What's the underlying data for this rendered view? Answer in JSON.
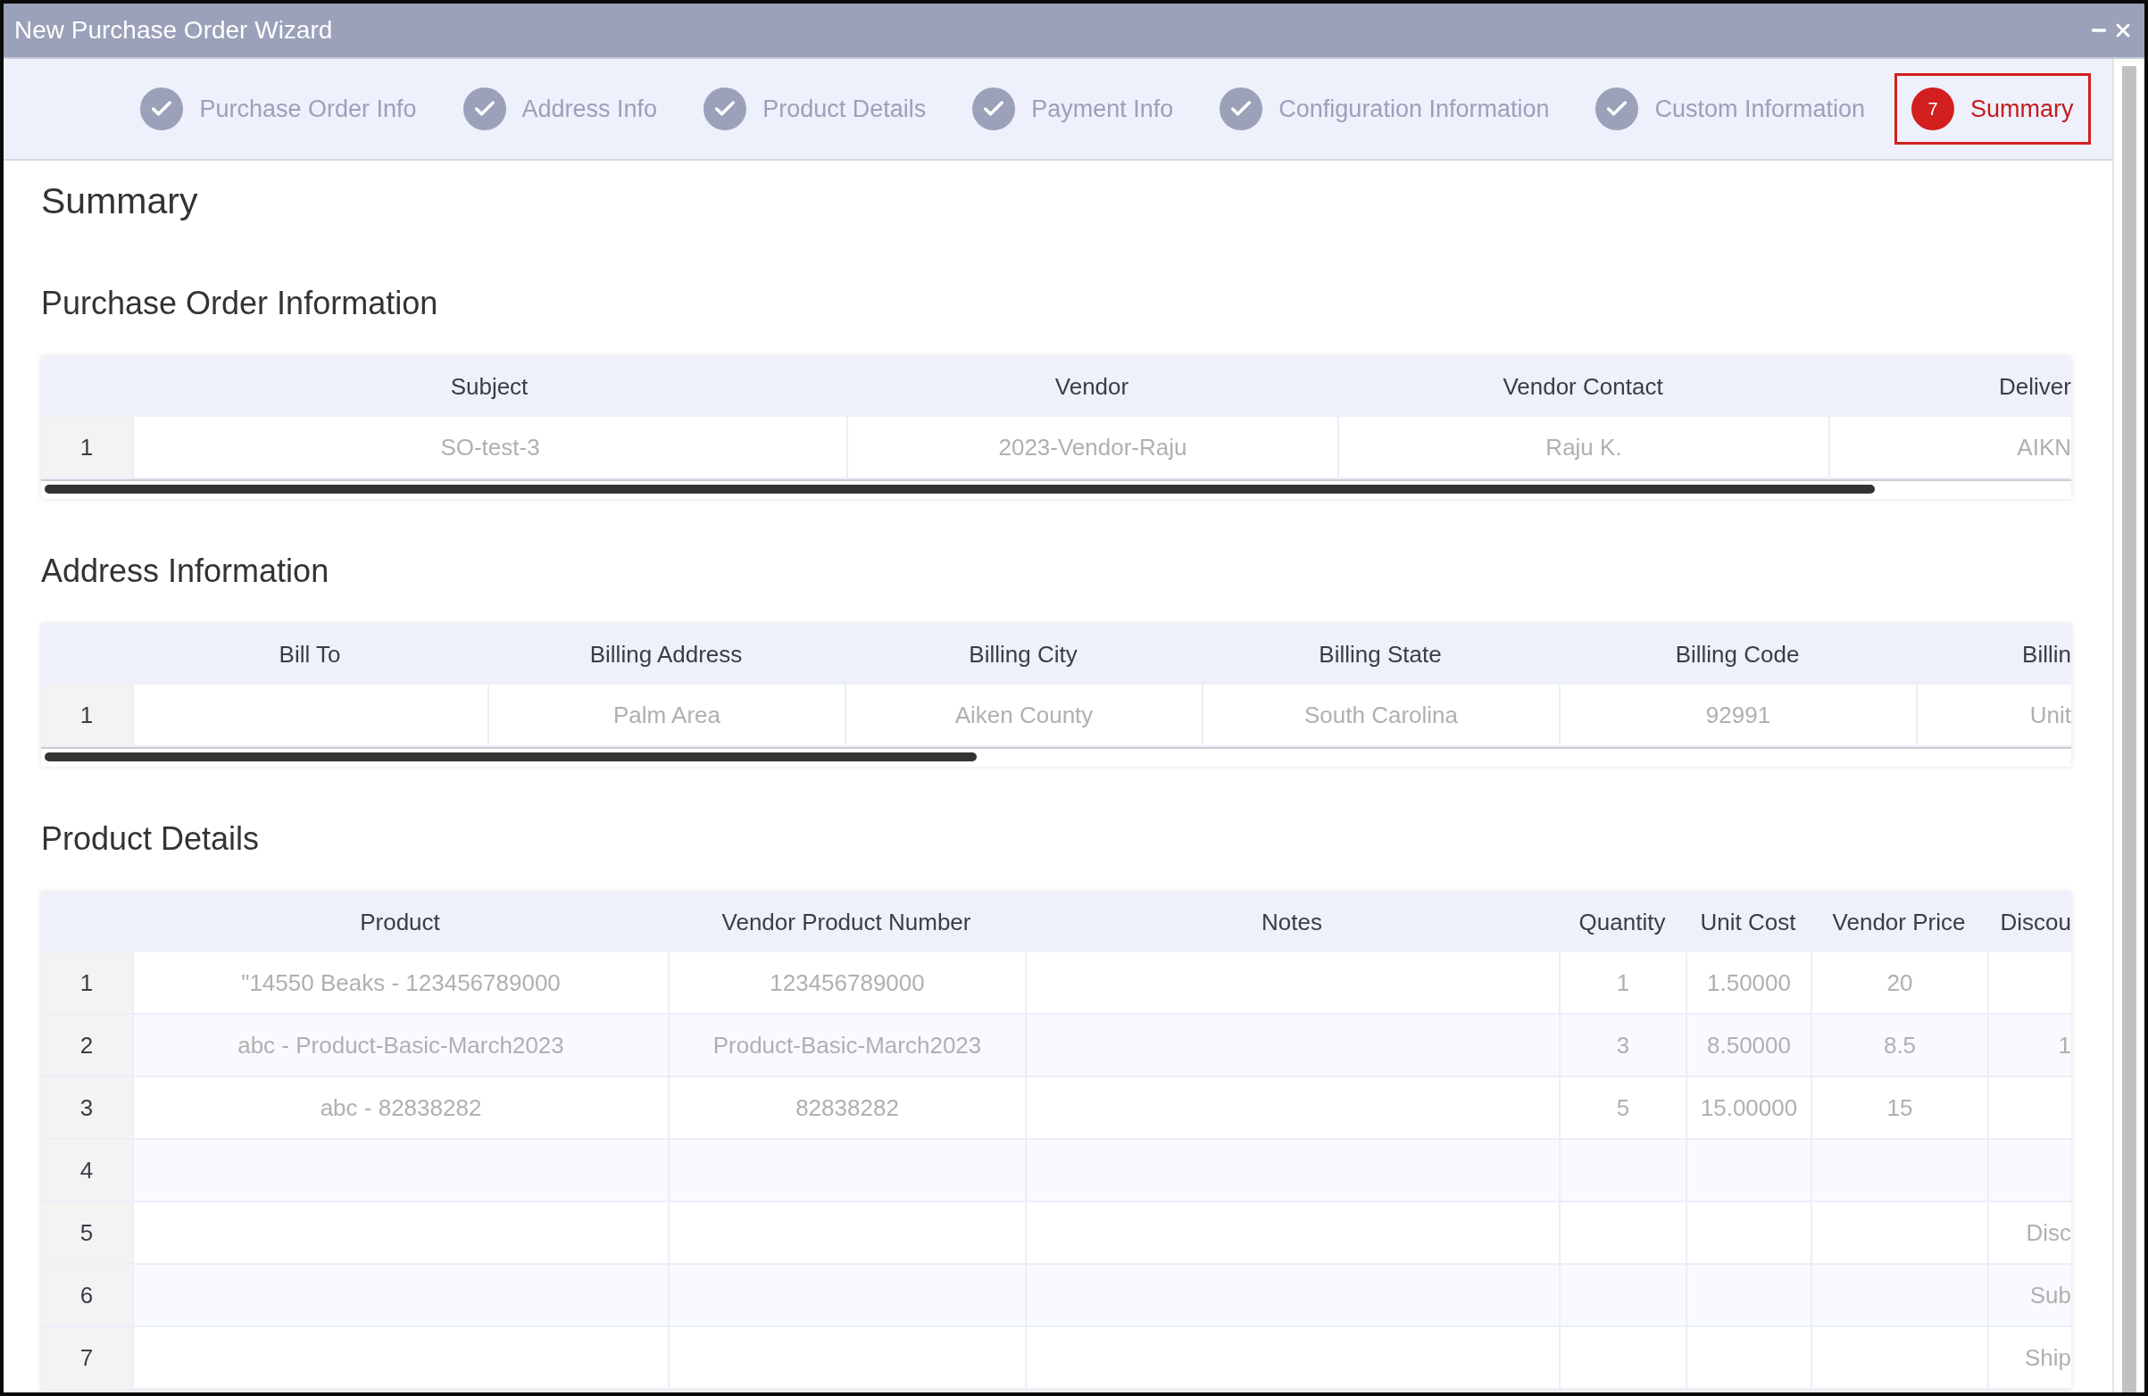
{
  "window": {
    "title": "New Purchase Order Wizard"
  },
  "steps": [
    {
      "label": "Purchase Order Info",
      "selected": false,
      "completed": true
    },
    {
      "label": "Address Info",
      "selected": false,
      "completed": true
    },
    {
      "label": "Product Details",
      "selected": false,
      "completed": true
    },
    {
      "label": "Payment Info",
      "selected": false,
      "completed": true
    },
    {
      "label": "Configuration Information",
      "selected": false,
      "completed": true
    },
    {
      "label": "Custom Information",
      "selected": false,
      "completed": true
    },
    {
      "label": "Summary",
      "number": "7",
      "selected": true,
      "completed": false
    }
  ],
  "page_title": "Summary",
  "sections": [
    {
      "title": "Purchase Order Information",
      "table": {
        "columns": [
          "Subject",
          "Vendor",
          "Vendor Contact",
          "Deliver"
        ],
        "rows": [
          {
            "index": "1",
            "cells": [
              "SO-test-3",
              "2023-Vendor-Raju",
              "Raju K.",
              "AIKN"
            ]
          }
        ]
      }
    },
    {
      "title": "Address Information",
      "table": {
        "columns": [
          "Bill To",
          "Billing Address",
          "Billing City",
          "Billing State",
          "Billing Code",
          "Billin"
        ],
        "rows": [
          {
            "index": "1",
            "cells": [
              null,
              "Palm Area",
              "Aiken County",
              "South Carolina",
              "92991",
              "Unit"
            ]
          }
        ]
      }
    },
    {
      "title": "Product Details",
      "table": {
        "columns": [
          "Product",
          "Vendor Product Number",
          "Notes",
          "Quantity",
          "Unit Cost",
          "Vendor Price",
          "Discou"
        ],
        "rows": [
          {
            "index": "1",
            "cells": [
              "\"14550 Beaks - 123456789000",
              "123456789000",
              null,
              "1",
              "1.50000",
              "20",
              null
            ]
          },
          {
            "index": "2",
            "cells": [
              "abc - Product-Basic-March2023",
              "Product-Basic-March2023",
              null,
              "3",
              "8.50000",
              "8.5",
              "1"
            ]
          },
          {
            "index": "3",
            "cells": [
              "abc - 82838282",
              "82838282",
              null,
              "5",
              "15.00000",
              "15",
              null
            ]
          },
          {
            "index": "4",
            "cells": [
              null,
              null,
              null,
              null,
              null,
              null,
              null
            ]
          },
          {
            "index": "5",
            "cells": [
              null,
              null,
              null,
              null,
              null,
              null,
              "Disc"
            ]
          },
          {
            "index": "6",
            "cells": [
              null,
              null,
              null,
              null,
              null,
              null,
              "Sub"
            ]
          },
          {
            "index": "7",
            "cells": [
              null,
              null,
              null,
              null,
              null,
              null,
              "Ship"
            ]
          }
        ]
      }
    }
  ]
}
